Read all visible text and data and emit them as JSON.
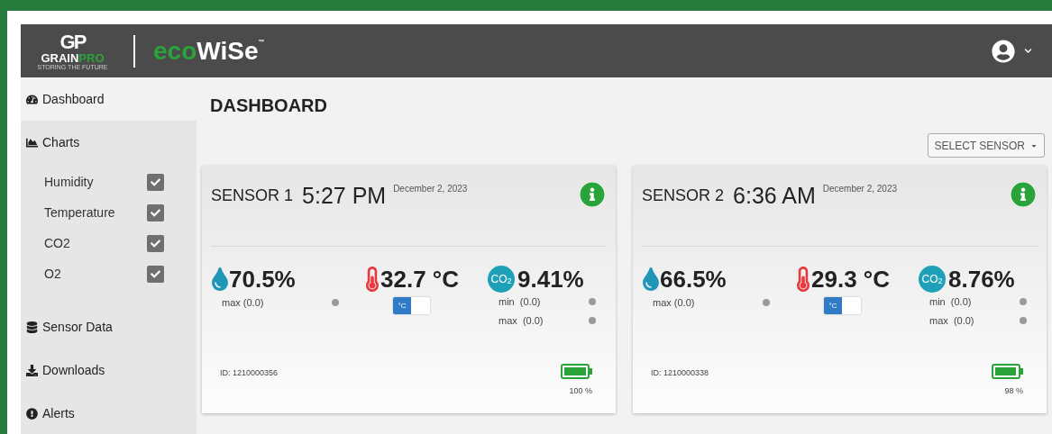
{
  "header": {
    "logo": {
      "mark": "GP",
      "name_white": "GRAIN",
      "name_green": "PRO",
      "tagline": "STORING THE FUTURE"
    },
    "product": {
      "green": "eco",
      "white": "WiSe",
      "tm": "™"
    }
  },
  "sidebar": {
    "items": [
      {
        "label": "Dashboard",
        "kind": "dashboard",
        "selected": true
      },
      {
        "label": "Charts",
        "kind": "charts",
        "selected": false,
        "children": [
          {
            "label": "Humidity",
            "checked": true
          },
          {
            "label": "Temperature",
            "checked": true
          },
          {
            "label": "CO2",
            "checked": true
          },
          {
            "label": "O2",
            "checked": true
          }
        ]
      },
      {
        "label": "Sensor Data",
        "kind": "data",
        "selected": false
      },
      {
        "label": "Downloads",
        "kind": "downloads",
        "selected": false
      },
      {
        "label": "Alerts",
        "kind": "alerts",
        "selected": false
      }
    ]
  },
  "page_title": "DASHBOARD",
  "select_sensor": "SELECT SENSOR",
  "sensors": [
    {
      "name": "SENSOR 1",
      "time": "5:27 PM",
      "date": "December 2, 2023",
      "humidity": "70.5%",
      "humidity_max": "max (0.0)",
      "temperature": "32.7 °C",
      "unit_toggle": {
        "label": "°C",
        "on": true
      },
      "co2_badge": "CO$_{2}$",
      "co2": "9.41%",
      "co2_min": "min  (0.0)",
      "co2_max": "max  (0.0)",
      "id": "ID: 1210000356",
      "battery": {
        "level": 1.0,
        "reading": "100 %"
      }
    },
    {
      "name": "SENSOR 2",
      "time": "6:36 AM",
      "date": "December 2, 2023",
      "humidity": "66.5%",
      "humidity_max": "max (0.0)",
      "temperature": "29.3 °C",
      "unit_toggle": {
        "label": "°C",
        "on": true
      },
      "co2_badge": "CO$_{2}$",
      "co2": "8.76%",
      "co2_min": "min  (0.0)",
      "co2_max": "max  (0.0)",
      "id": "ID: 1210000338",
      "battery": {
        "level": 0.98,
        "reading": "98 %"
      }
    }
  ]
}
